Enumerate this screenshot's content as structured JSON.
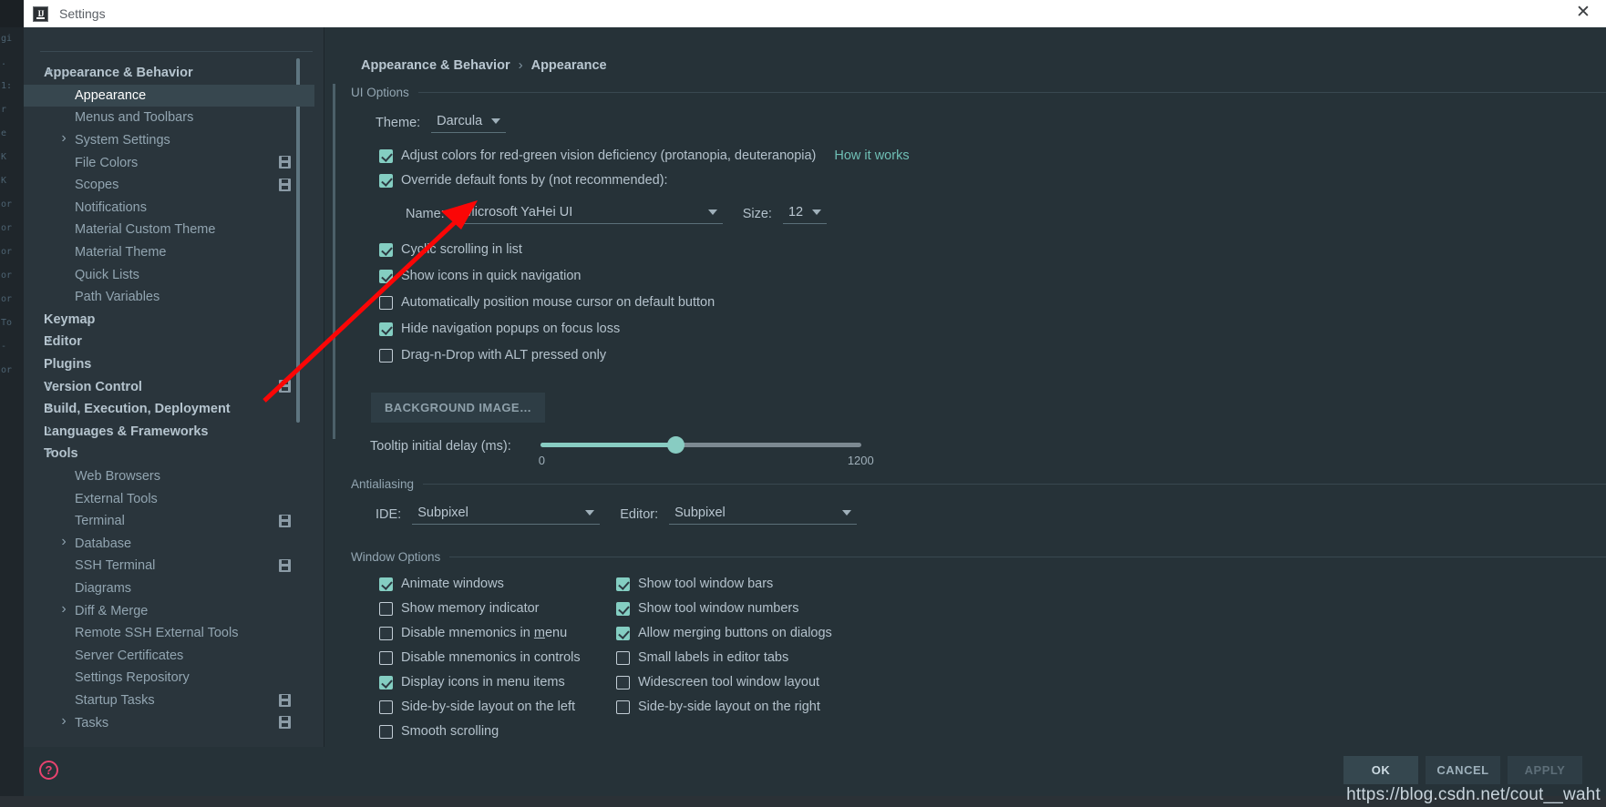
{
  "window": {
    "title": "Settings",
    "app_icon": "IJ",
    "close_label": "✕"
  },
  "sidebar": {
    "items": [
      {
        "label": "Appearance & Behavior",
        "level": "group",
        "arrow": "down",
        "selected": false,
        "badge": false
      },
      {
        "label": "Appearance",
        "level": "child",
        "arrow": "none",
        "selected": true,
        "badge": false
      },
      {
        "label": "Menus and Toolbars",
        "level": "child",
        "arrow": "none",
        "selected": false,
        "badge": false
      },
      {
        "label": "System Settings",
        "level": "child",
        "arrow": "right",
        "selected": false,
        "badge": false
      },
      {
        "label": "File Colors",
        "level": "child",
        "arrow": "none",
        "selected": false,
        "badge": true
      },
      {
        "label": "Scopes",
        "level": "child",
        "arrow": "none",
        "selected": false,
        "badge": true
      },
      {
        "label": "Notifications",
        "level": "child",
        "arrow": "none",
        "selected": false,
        "badge": false
      },
      {
        "label": "Material Custom Theme",
        "level": "child",
        "arrow": "none",
        "selected": false,
        "badge": false
      },
      {
        "label": "Material Theme",
        "level": "child",
        "arrow": "none",
        "selected": false,
        "badge": false
      },
      {
        "label": "Quick Lists",
        "level": "child",
        "arrow": "none",
        "selected": false,
        "badge": false
      },
      {
        "label": "Path Variables",
        "level": "child",
        "arrow": "none",
        "selected": false,
        "badge": false
      },
      {
        "label": "Keymap",
        "level": "group",
        "arrow": "none",
        "selected": false,
        "badge": false
      },
      {
        "label": "Editor",
        "level": "group",
        "arrow": "right",
        "selected": false,
        "badge": false
      },
      {
        "label": "Plugins",
        "level": "group",
        "arrow": "none",
        "selected": false,
        "badge": false
      },
      {
        "label": "Version Control",
        "level": "group",
        "arrow": "right",
        "selected": false,
        "badge": true
      },
      {
        "label": "Build, Execution, Deployment",
        "level": "group",
        "arrow": "right",
        "selected": false,
        "badge": false
      },
      {
        "label": "Languages & Frameworks",
        "level": "group",
        "arrow": "right",
        "selected": false,
        "badge": false
      },
      {
        "label": "Tools",
        "level": "group",
        "arrow": "down",
        "selected": false,
        "badge": false
      },
      {
        "label": "Web Browsers",
        "level": "child",
        "arrow": "none",
        "selected": false,
        "badge": false
      },
      {
        "label": "External Tools",
        "level": "child",
        "arrow": "none",
        "selected": false,
        "badge": false
      },
      {
        "label": "Terminal",
        "level": "child",
        "arrow": "none",
        "selected": false,
        "badge": true
      },
      {
        "label": "Database",
        "level": "child",
        "arrow": "right",
        "selected": false,
        "badge": false
      },
      {
        "label": "SSH Terminal",
        "level": "child",
        "arrow": "none",
        "selected": false,
        "badge": true
      },
      {
        "label": "Diagrams",
        "level": "child",
        "arrow": "none",
        "selected": false,
        "badge": false
      },
      {
        "label": "Diff & Merge",
        "level": "child",
        "arrow": "right",
        "selected": false,
        "badge": false
      },
      {
        "label": "Remote SSH External Tools",
        "level": "child",
        "arrow": "none",
        "selected": false,
        "badge": false
      },
      {
        "label": "Server Certificates",
        "level": "child",
        "arrow": "none",
        "selected": false,
        "badge": false
      },
      {
        "label": "Settings Repository",
        "level": "child",
        "arrow": "none",
        "selected": false,
        "badge": false
      },
      {
        "label": "Startup Tasks",
        "level": "child",
        "arrow": "none",
        "selected": false,
        "badge": true
      },
      {
        "label": "Tasks",
        "level": "child",
        "arrow": "right",
        "selected": false,
        "badge": true
      }
    ]
  },
  "breadcrumb": {
    "parent": "Appearance & Behavior",
    "separator": "›",
    "current": "Appearance"
  },
  "ui_options": {
    "section_title": "UI Options",
    "theme_label": "Theme:",
    "theme_value": "Darcula",
    "adjust_colors": {
      "label": "Adjust colors for red-green vision deficiency (protanopia, deuteranopia)",
      "checked": true
    },
    "how_it_works_link": "How it works",
    "override_fonts": {
      "label": "Override default fonts by (not recommended):",
      "checked": true
    },
    "font_name_label": "Name:",
    "font_name_value": "Microsoft YaHei UI",
    "font_size_label": "Size:",
    "font_size_value": "12",
    "checkboxes": [
      {
        "label": "Cyclic scrolling in list",
        "checked": true
      },
      {
        "label": "Show icons in quick navigation",
        "checked": true
      },
      {
        "label": "Automatically position mouse cursor on default button",
        "checked": false
      },
      {
        "label": "Hide navigation popups on focus loss",
        "checked": true
      },
      {
        "label": "Drag-n-Drop with ALT pressed only",
        "checked": false
      }
    ],
    "background_image_button": "BACKGROUND IMAGE…",
    "tooltip_delay_label": "Tooltip initial delay (ms):",
    "tooltip_delay_min": "0",
    "tooltip_delay_max": "1200",
    "tooltip_delay_percent": 42
  },
  "antialiasing": {
    "section_title": "Antialiasing",
    "ide_label": "IDE:",
    "ide_value": "Subpixel",
    "editor_label": "Editor:",
    "editor_value": "Subpixel"
  },
  "window_options": {
    "section_title": "Window Options",
    "left_column": [
      {
        "label": "Animate windows",
        "checked": true,
        "mnemonic": ""
      },
      {
        "label": "Show memory indicator",
        "checked": false,
        "mnemonic": ""
      },
      {
        "label": "Disable mnemonics in menu",
        "checked": false,
        "mnemonic": "m"
      },
      {
        "label": "Disable mnemonics in controls",
        "checked": false,
        "mnemonic": ""
      },
      {
        "label": "Display icons in menu items",
        "checked": true,
        "mnemonic": ""
      },
      {
        "label": "Side-by-side layout on the left",
        "checked": false,
        "mnemonic": ""
      },
      {
        "label": "Smooth scrolling",
        "checked": false,
        "mnemonic": ""
      }
    ],
    "right_column": [
      {
        "label": "Show tool window bars",
        "checked": true,
        "mnemonic": ""
      },
      {
        "label": "Show tool window numbers",
        "checked": true,
        "mnemonic": ""
      },
      {
        "label": "Allow merging buttons on dialogs",
        "checked": true,
        "mnemonic": ""
      },
      {
        "label": "Small labels in editor tabs",
        "checked": false,
        "mnemonic": ""
      },
      {
        "label": "Widescreen tool window layout",
        "checked": false,
        "mnemonic": ""
      },
      {
        "label": "Side-by-side layout on the right",
        "checked": false,
        "mnemonic": ""
      }
    ]
  },
  "footer": {
    "help_icon": "?",
    "ok": "OK",
    "cancel": "CANCEL",
    "apply": "APPLY"
  },
  "watermark": "https://blog.csdn.net/cout__waht",
  "colors": {
    "accent": "#88ccc2",
    "link": "#6fbfb5",
    "panel": "#263238",
    "sidebar": "#2a353c",
    "selection": "#37474f",
    "annotation": "#fb0606"
  },
  "bg_code_lines": [
    "gi",
    ".",
    "1:",
    "r",
    "e",
    "K",
    "K",
    "or",
    "or",
    "or",
    "or",
    "or",
    "To",
    "-",
    "or"
  ]
}
